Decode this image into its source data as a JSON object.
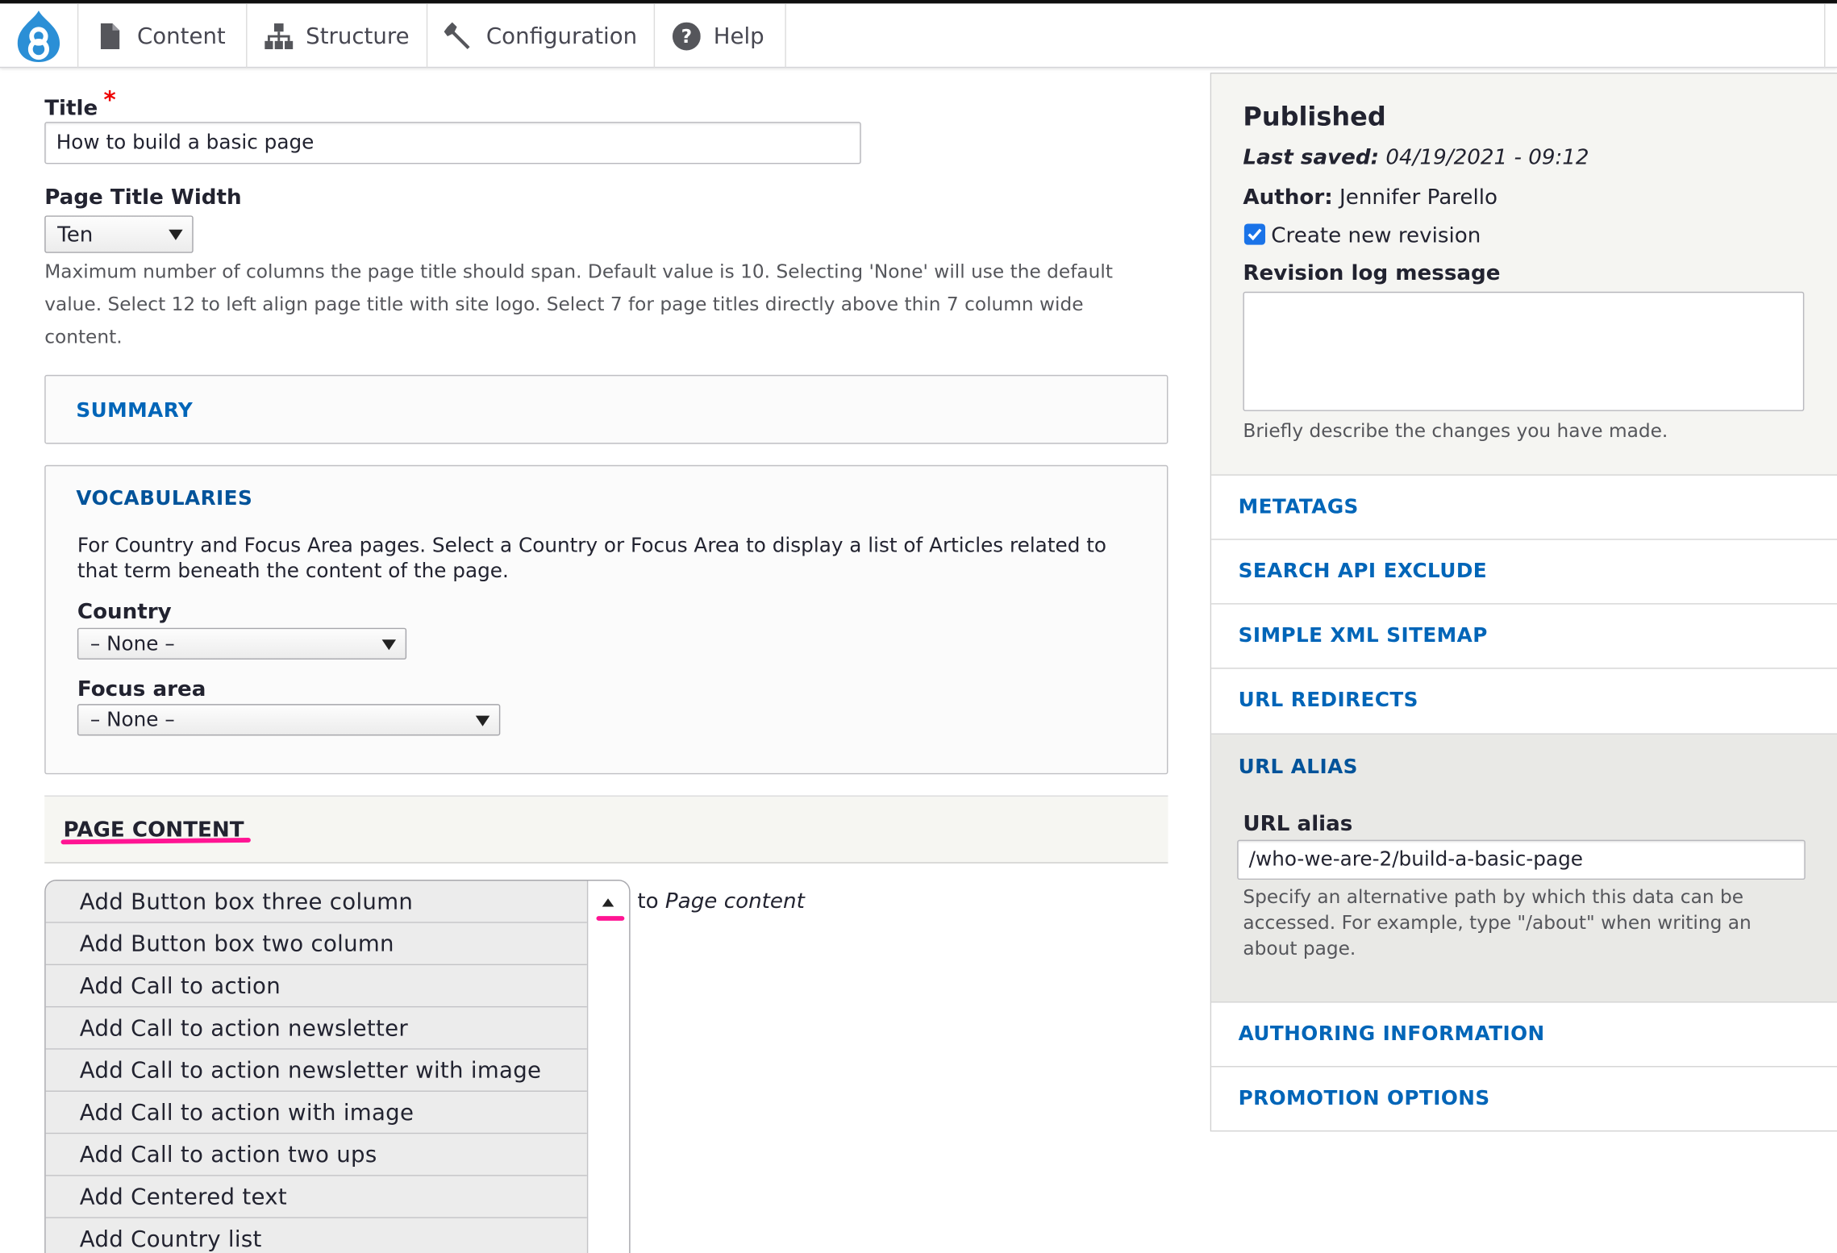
{
  "toolbar": {
    "logo_icon": "drupal-logo",
    "items": [
      {
        "label": "Content",
        "icon": "document-icon"
      },
      {
        "label": "Structure",
        "icon": "sitemap-icon"
      },
      {
        "label": "Configuration",
        "icon": "wrench-icon"
      },
      {
        "label": "Help",
        "icon": "question-icon"
      }
    ]
  },
  "form": {
    "title_label": "Title",
    "required_mark": "*",
    "title_value": "How to build a basic page",
    "page_title_width_label": "Page Title Width",
    "page_title_width_value": "Ten",
    "page_title_width_desc_1": "Maximum number of columns the page title should span. Default value is 10. Selecting 'None' will use the default",
    "page_title_width_desc_2": "value. Select 12 to left align page title with site logo. Select 7 for page titles directly above thin 7 column wide",
    "page_title_width_desc_3": "content.",
    "summary_label": "SUMMARY",
    "vocabularies": {
      "title": "VOCABULARIES",
      "desc_1": "For Country and Focus Area pages. Select a Country or Focus Area to display a list of Articles related to",
      "desc_2": "that term beneath the content of the page.",
      "country_label": "Country",
      "country_value": "– None –",
      "focus_label": "Focus area",
      "focus_value": "– None –"
    },
    "page_content_label": "PAGE CONTENT",
    "add_options": [
      "Add Button box three column",
      "Add Button box two column",
      "Add Call to action",
      "Add Call to action newsletter",
      "Add Call to action newsletter with image",
      "Add Call to action with image",
      "Add Call to action two ups",
      "Add Centered text",
      "Add Country list"
    ],
    "to_text": "to",
    "to_target": "Page content"
  },
  "sidebar": {
    "status": "Published",
    "last_saved_label": "Last saved:",
    "last_saved_value": "04/19/2021 - 09:12",
    "author_label": "Author:",
    "author_value": "Jennifer Parello",
    "revision_checkbox_label": "Create new revision",
    "revision_checked": true,
    "revision_log_label": "Revision log message",
    "revision_log_value": "",
    "revision_log_desc": "Briefly describe the changes you have made.",
    "sections": [
      "METATAGS",
      "SEARCH API EXCLUDE",
      "SIMPLE XML SITEMAP",
      "URL REDIRECTS"
    ],
    "url_alias_section": "URL ALIAS",
    "url_alias_label": "URL alias",
    "url_alias_value": "/who-we-are-2/build-a-basic-page",
    "url_alias_desc_1": "Specify an alternative path by which this data can be",
    "url_alias_desc_2": "accessed. For example, type \"/about\" when writing an",
    "url_alias_desc_3": "about page.",
    "bottom_sections": [
      "AUTHORING INFORMATION",
      "PROMOTION OPTIONS"
    ]
  },
  "colors": {
    "link": "#0065b8",
    "annotation": "#ff1493",
    "required": "#e00000"
  }
}
